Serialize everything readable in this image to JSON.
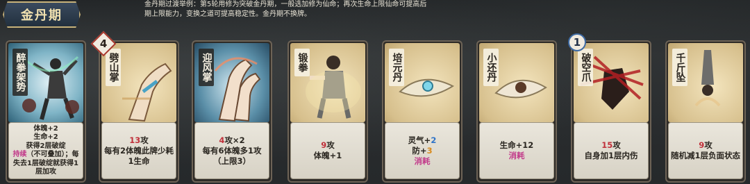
{
  "stage": {
    "title": "金丹期"
  },
  "description": "金丹期过渡举例：第5轮用修为突破金丹期，一般选加修为仙命；再次生命上限仙命可提高后期上限能力，变换之道可提高稳定性。金丹期不换牌。",
  "cards": [
    {
      "name": "醉拳架势",
      "lines": [
        "体魄+2",
        "生命+2",
        "获得2层破绽"
      ],
      "keyword": "持续",
      "keyword_note": "（不可叠加）；每失去1层破绽就获得1层加攻",
      "style": "dark"
    },
    {
      "name": "劈山掌",
      "cost": "4",
      "attack": "13",
      "attack_unit": "攻",
      "effect": "每有2体魄此牌少耗1生命"
    },
    {
      "name": "迎风掌",
      "attack": "4",
      "attack_unit": "攻×2",
      "effect": "每有6体魄多1攻（上限3）"
    },
    {
      "name": "锻拳",
      "attack": "9",
      "attack_unit": "攻",
      "effect": "体魄+1"
    },
    {
      "name": "培元丹",
      "stat1_label": "灵气+",
      "stat1_value": "2",
      "stat2_label": "防+",
      "stat2_value": "3",
      "keyword": "消耗"
    },
    {
      "name": "小还丹",
      "effect": "生命+12",
      "keyword": "消耗"
    },
    {
      "name": "破空爪",
      "cost": "1",
      "attack": "15",
      "attack_unit": "攻",
      "effect": "自身加1层内伤"
    },
    {
      "name": "千斤坠",
      "attack": "9",
      "attack_unit": "攻",
      "effect": "随机减1层负面状态"
    }
  ]
}
